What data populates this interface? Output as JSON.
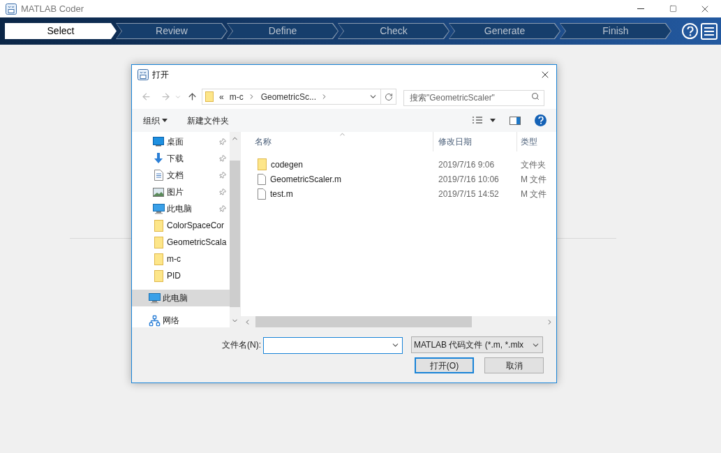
{
  "window": {
    "title": "MATLAB Coder"
  },
  "steps": [
    {
      "label": "Select",
      "selected": true
    },
    {
      "label": "Review",
      "selected": false
    },
    {
      "label": "Define",
      "selected": false
    },
    {
      "label": "Check",
      "selected": false
    },
    {
      "label": "Generate",
      "selected": false
    },
    {
      "label": "Finish",
      "selected": false
    }
  ],
  "dialog": {
    "title": "打开",
    "address": {
      "overflow": "«",
      "path": [
        "m-c",
        "GeometricSc..."
      ]
    },
    "search": {
      "placeholder": "搜索\"GeometricScaler\""
    },
    "toolbar": {
      "organize": "组织",
      "new_folder": "新建文件夹"
    },
    "quick_access": [
      {
        "label": "桌面",
        "kind": "desktop",
        "pinned": true,
        "selected": false
      },
      {
        "label": "下载",
        "kind": "download",
        "pinned": true,
        "selected": false
      },
      {
        "label": "文档",
        "kind": "document",
        "pinned": true,
        "selected": false
      },
      {
        "label": "图片",
        "kind": "picture",
        "pinned": true,
        "selected": false
      },
      {
        "label": "此电脑",
        "kind": "computer",
        "pinned": true,
        "selected": false
      },
      {
        "label": "ColorSpaceCor",
        "kind": "folder",
        "pinned": false,
        "selected": false
      },
      {
        "label": "GeometricScala",
        "kind": "folder",
        "pinned": false,
        "selected": false
      },
      {
        "label": "m-c",
        "kind": "folder",
        "pinned": false,
        "selected": false
      },
      {
        "label": "PID",
        "kind": "folder",
        "pinned": false,
        "selected": false
      }
    ],
    "locations": [
      {
        "label": "此电脑",
        "kind": "computer",
        "selected": true
      },
      {
        "label": "网络",
        "kind": "network",
        "selected": false
      }
    ],
    "columns": [
      "名称",
      "修改日期",
      "类型"
    ],
    "files": [
      {
        "name": "codegen",
        "kind": "folder",
        "modified": "2019/7/16 9:06",
        "type": "文件夹"
      },
      {
        "name": "GeometricScaler.m",
        "kind": "file",
        "modified": "2019/7/16 10:06",
        "type": "M 文件"
      },
      {
        "name": "test.m",
        "kind": "file",
        "modified": "2019/7/15 14:52",
        "type": "M 文件"
      }
    ],
    "filename": {
      "label": "文件名(N):"
    },
    "filetype": {
      "value": "MATLAB 代码文件 (*.m, *.mlx"
    },
    "buttons": [
      {
        "label": "打开(O)",
        "default": true
      },
      {
        "label": "取消",
        "default": false
      }
    ]
  }
}
